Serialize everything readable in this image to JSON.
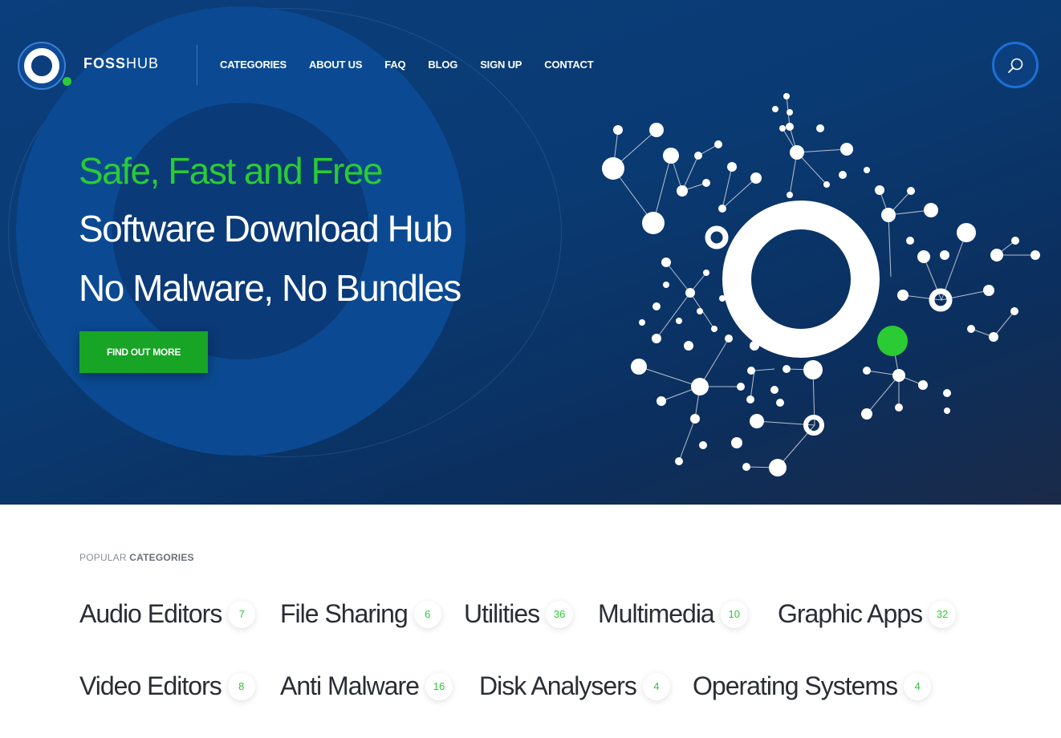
{
  "brand": {
    "logo_bold": "FOSS",
    "logo_light": "HUB"
  },
  "nav": {
    "items": [
      {
        "label": "CATEGORIES"
      },
      {
        "label": "ABOUT US"
      },
      {
        "label": "FAQ"
      },
      {
        "label": "BLOG"
      },
      {
        "label": "SIGN UP"
      },
      {
        "label": "CONTACT"
      }
    ]
  },
  "search": {
    "icon": "search-icon"
  },
  "hero": {
    "headline_green": "Safe, Fast and Free",
    "headline_line2": "Software Download Hub",
    "headline_line3": "No Malware, No Bundles",
    "cta_label": "FIND OUT MORE"
  },
  "popular": {
    "label_light": "POPULAR ",
    "label_bold": "CATEGORIES",
    "categories": [
      {
        "name": "Audio Editors",
        "count": "7"
      },
      {
        "name": "File Sharing",
        "count": "6"
      },
      {
        "name": "Utilities",
        "count": "36"
      },
      {
        "name": "Multimedia",
        "count": "10"
      },
      {
        "name": "Graphic Apps",
        "count": "32"
      },
      {
        "name": "Video Editors",
        "count": "8"
      },
      {
        "name": "Anti Malware",
        "count": "16"
      },
      {
        "name": "Disk Analysers",
        "count": "4"
      },
      {
        "name": "Operating Systems",
        "count": "4"
      }
    ]
  },
  "colors": {
    "accent_green": "#2bcb34",
    "hero_blue": "#0a3e7c",
    "cta_green": "#18a424"
  }
}
